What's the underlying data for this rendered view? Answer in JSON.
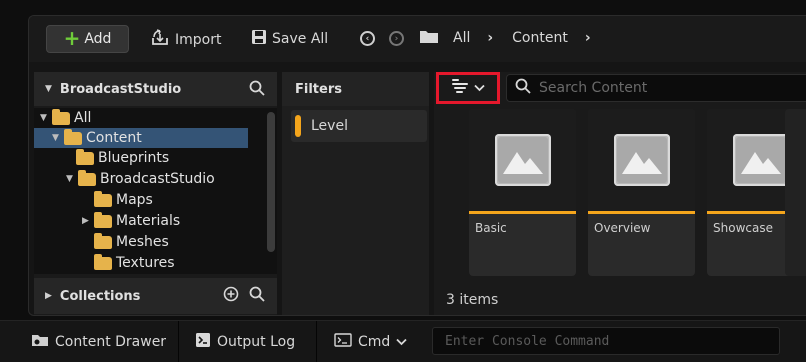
{
  "toolbar": {
    "add_label": "Add",
    "import_label": "Import",
    "save_all_label": "Save All",
    "breadcrumb": [
      "All",
      "Content"
    ]
  },
  "sources": {
    "title": "BroadcastStudio",
    "tree": [
      {
        "label": "All",
        "depth": 0,
        "expanded": true,
        "selected": false
      },
      {
        "label": "Content",
        "depth": 1,
        "expanded": true,
        "selected": true
      },
      {
        "label": "Blueprints",
        "depth": 2,
        "expanded": false,
        "selected": false
      },
      {
        "label": "BroadcastStudio",
        "depth": 2,
        "expanded": true,
        "selected": false
      },
      {
        "label": "Maps",
        "depth": 3,
        "expanded": false,
        "selected": false
      },
      {
        "label": "Materials",
        "depth": 3,
        "expanded": false,
        "selected": false
      },
      {
        "label": "Meshes",
        "depth": 3,
        "expanded": false,
        "selected": false
      },
      {
        "label": "Textures",
        "depth": 3,
        "expanded": false,
        "selected": false
      }
    ],
    "collections_label": "Collections"
  },
  "filters": {
    "title": "Filters",
    "items": [
      {
        "label": "Level",
        "color": "#f4a51c"
      }
    ]
  },
  "content": {
    "search_placeholder": "Search Content",
    "assets": [
      {
        "name": "Basic"
      },
      {
        "name": "Overview"
      },
      {
        "name": "Showcase"
      }
    ],
    "items_count": "3 items"
  },
  "bottombar": {
    "content_drawer_label": "Content Drawer",
    "output_log_label": "Output Log",
    "cmd_label": "Cmd",
    "console_placeholder": "Enter Console Command"
  },
  "colors": {
    "accent": "#f4a51c",
    "highlight_box": "#e5182c",
    "selection": "#345476",
    "folder": "#e6b34b",
    "add_plus": "#6fcc3a"
  }
}
